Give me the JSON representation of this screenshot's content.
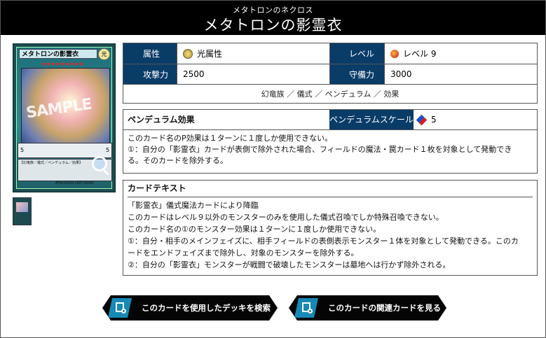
{
  "header": {
    "ruby": "メタトロンのネクロス",
    "title": "メタトロンの影霊衣"
  },
  "card_image": {
    "name": "メタトロンの影霊衣",
    "attribute_mark": "光",
    "stars": "★★★★★★★★★",
    "watermark": "SAMPLE",
    "scale_left": "5",
    "scale_right": "5",
    "type_line": "【幻竜族／儀式／ペンデュラム／効果】",
    "stats": "ATK/2500 DEF/3000"
  },
  "info": {
    "attribute_label": "属性",
    "attribute_value": "光属性",
    "level_label": "レベル",
    "level_value": "レベル 9",
    "atk_label": "攻撃力",
    "atk_value": "2500",
    "def_label": "守備力",
    "def_value": "3000",
    "types": "幻竜族 ／ 儀式 ／ ペンデュラム ／ 効果"
  },
  "pendulum": {
    "label": "ペンデュラム効果",
    "scale_label": "ペンデュラムスケール",
    "scale_value": "5",
    "lines": [
      "このカード名のP効果は１ターンに１度しか使用できない。",
      "①：自分の「影霊衣」カードが表側で除外された場合、フィールドの魔法・罠カード１枚を対象として発動でき",
      "る。そのカードを除外する。"
    ]
  },
  "card_text": {
    "label": "カードテキスト",
    "lines": [
      "「影霊衣」儀式魔法カードにより降臨",
      "このカードはレベル９以外のモンスターのみを使用した儀式召喚でしか特殊召喚できない。",
      "このカード名の①のモンスター効果は１ターンに１度しか使用できない。",
      "①：自分・相手のメインフェイズに、相手フィールドの表側表示モンスター１体を対象として発動できる。このカ",
      "ードをエンドフェイズまで除外し、対象のモンスターを除外する。",
      "②：自分の「影霊衣」モンスターが戦闘で破壊したモンスターは墓地へは行かず除外される。"
    ]
  },
  "buttons": {
    "deck_search": "このカードを使用したデッキを検索",
    "related_cards": "このカードの関連カードを見る"
  },
  "colors": {
    "header_bg": "#000000",
    "label_bg": "#0a3c68",
    "button_icon": "#1689b6"
  }
}
